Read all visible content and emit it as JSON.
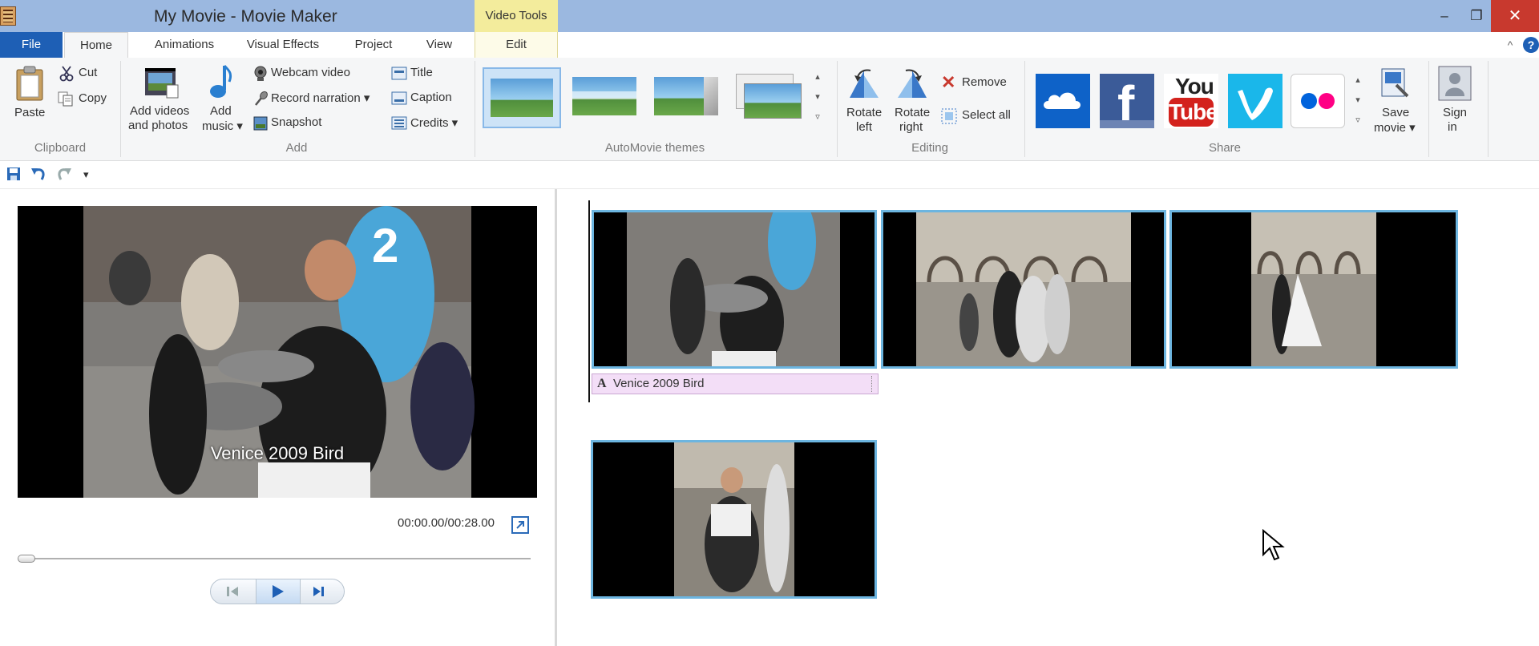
{
  "window": {
    "title": "My Movie - Movie Maker",
    "context_tab": "Video Tools",
    "minimize": "–",
    "restore": "❐",
    "close": "✕"
  },
  "menu_tabs": [
    "File",
    "Home",
    "Animations",
    "Visual Effects",
    "Project",
    "View",
    "Edit"
  ],
  "help": "?",
  "ribbon": {
    "clipboard": {
      "paste": "Paste",
      "cut": "Cut",
      "copy": "Copy",
      "group": "Clipboard"
    },
    "add": {
      "add_videos_line1": "Add videos",
      "add_videos_line2": "and photos",
      "add_music_line1": "Add",
      "add_music_line2": "music ▾",
      "webcam": "Webcam video",
      "record_narration": "Record narration ▾",
      "snapshot": "Snapshot",
      "title": "Title",
      "caption": "Caption",
      "credits": "Credits ▾",
      "group": "Add"
    },
    "themes": {
      "group": "AutoMovie themes"
    },
    "editing": {
      "rotate_left_1": "Rotate",
      "rotate_left_2": "left",
      "rotate_right_1": "Rotate",
      "rotate_right_2": "right",
      "remove": "Remove",
      "select_all": "Select all",
      "group": "Editing"
    },
    "share": {
      "save_movie_1": "Save",
      "save_movie_2": "movie ▾",
      "sign_in_1": "Sign",
      "sign_in_2": "in",
      "group": "Share",
      "youtube_1": "You",
      "youtube_2": "Tube"
    }
  },
  "preview": {
    "caption_overlay": "Venice 2009 Bird",
    "time": "00:00.00/00:28.00",
    "progress_fraction": 0.0
  },
  "storyboard": {
    "caption_clip": "Venice 2009 Bird",
    "caption_icon": "A"
  },
  "colors": {
    "file_tab": "#1e5fb5",
    "context_tab": "#f3ec9c",
    "clip_border": "#6cb5e0",
    "caption_clip": "#f3def7",
    "close": "#c8392e"
  }
}
